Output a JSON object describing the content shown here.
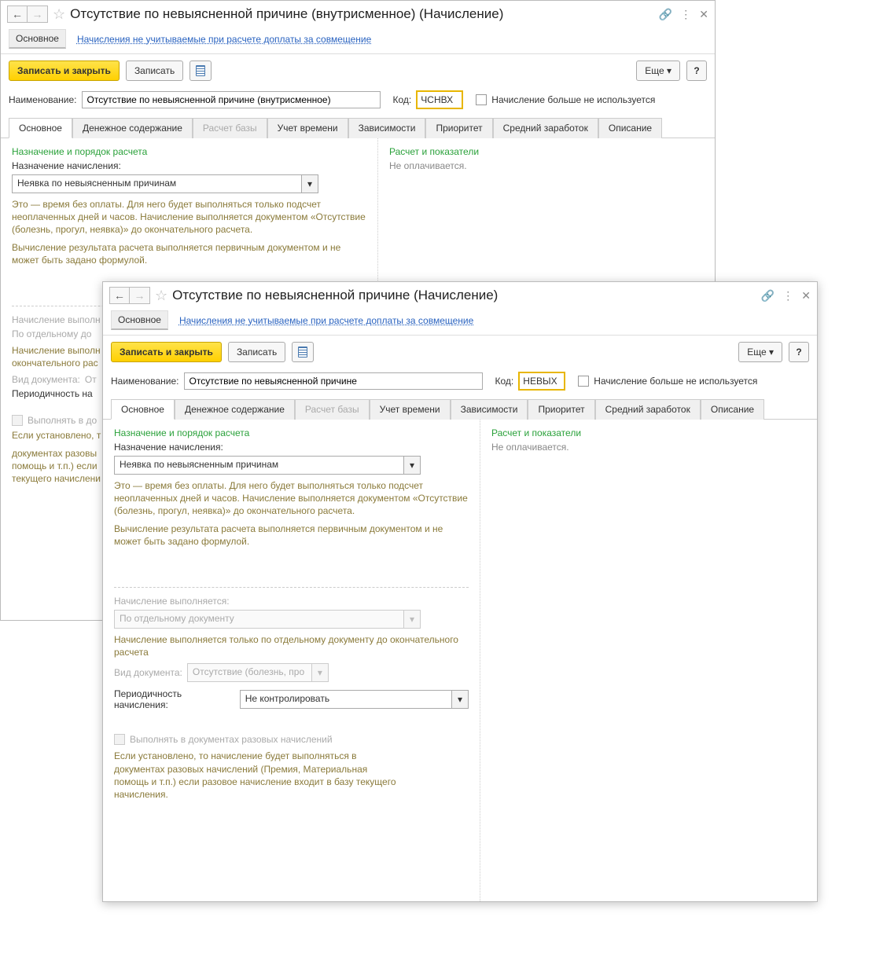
{
  "back": {
    "title": "Отсутствие по невыясненной причине (внутрисменное) (Начисление)",
    "nav_main": "Основное",
    "nav_link": "Начисления не учитываемые при расчете доплаты за совмещение",
    "btn_save_close": "Записать и закрыть",
    "btn_save": "Записать",
    "btn_more": "Еще",
    "btn_help": "?",
    "lbl_name": "Наименование:",
    "val_name": "Отсутствие по невыясненной причине (внутрисменное)",
    "lbl_code": "Код:",
    "val_code": "ЧСНВХ",
    "chk_notused": "Начисление больше не используется",
    "tabs": [
      "Основное",
      "Денежное содержание",
      "Расчет базы",
      "Учет времени",
      "Зависимости",
      "Приоритет",
      "Средний заработок",
      "Описание"
    ],
    "sec_left": "Назначение и порядок расчета",
    "lbl_purpose": "Назначение начисления:",
    "val_purpose": "Неявка по невыясненным причинам",
    "hint1": "Это — время без оплаты. Для него будет выполняться только подсчет неоплаченных дней и часов. Начисление выполняется документом «Отсутствие (болезнь, прогул, неявка)» до окончательного расчета.",
    "hint1b": "Вычисление результата расчета выполняется первичным документом и не может быть задано формулой.",
    "lbl_exec": "Начисление выполн",
    "val_exec": "По отдельному до",
    "hint2": "Начисление выполн\nокончательного рас",
    "lbl_doctype": "Вид документа:",
    "val_doctype": "От",
    "lbl_period": "Периодичность на",
    "chk_razov": "Выполнять в до",
    "hint3a": "Если установлено, т",
    "hint3b": "документах разовы",
    "hint3c": "помощь и т.п.) если",
    "hint3d": "текущего начислени",
    "sec_right": "Расчет и показатели",
    "right_text": "Не оплачивается."
  },
  "front": {
    "title": "Отсутствие по невыясненной причине (Начисление)",
    "nav_main": "Основное",
    "nav_link": "Начисления не учитываемые при расчете доплаты за совмещение",
    "btn_save_close": "Записать и закрыть",
    "btn_save": "Записать",
    "btn_more": "Еще",
    "btn_help": "?",
    "lbl_name": "Наименование:",
    "val_name": "Отсутствие по невыясненной причине",
    "lbl_code": "Код:",
    "val_code": "НЕВЫХ",
    "chk_notused": "Начисление больше не используется",
    "tabs": [
      "Основное",
      "Денежное содержание",
      "Расчет базы",
      "Учет времени",
      "Зависимости",
      "Приоритет",
      "Средний заработок",
      "Описание"
    ],
    "sec_left": "Назначение и порядок расчета",
    "lbl_purpose": "Назначение начисления:",
    "val_purpose": "Неявка по невыясненным причинам",
    "hint1": "Это — время без оплаты. Для него будет выполняться только подсчет неоплаченных дней и часов. Начисление выполняется документом «Отсутствие (болезнь, прогул, неявка)» до окончательного расчета.",
    "hint1b": "Вычисление результата расчета выполняется первичным документом и не может быть задано формулой.",
    "lbl_exec": "Начисление выполняется:",
    "val_exec": "По отдельному документу",
    "hint2": "Начисление выполняется только по отдельному документу до окончательного расчета",
    "lbl_doctype": "Вид документа:",
    "val_doctype": "Отсутствие (болезнь, про",
    "lbl_period": "Периодичность начисления:",
    "val_period": "Не контролировать",
    "chk_razov": "Выполнять в документах разовых начислений",
    "hint3": "Если установлено, то начисление будет выполняться в документах разовых начислений (Премия, Материальная помощь и т.п.) если разовое начисление входит в базу текущего начисления.",
    "sec_right": "Расчет и показатели",
    "right_text": "Не оплачивается."
  }
}
